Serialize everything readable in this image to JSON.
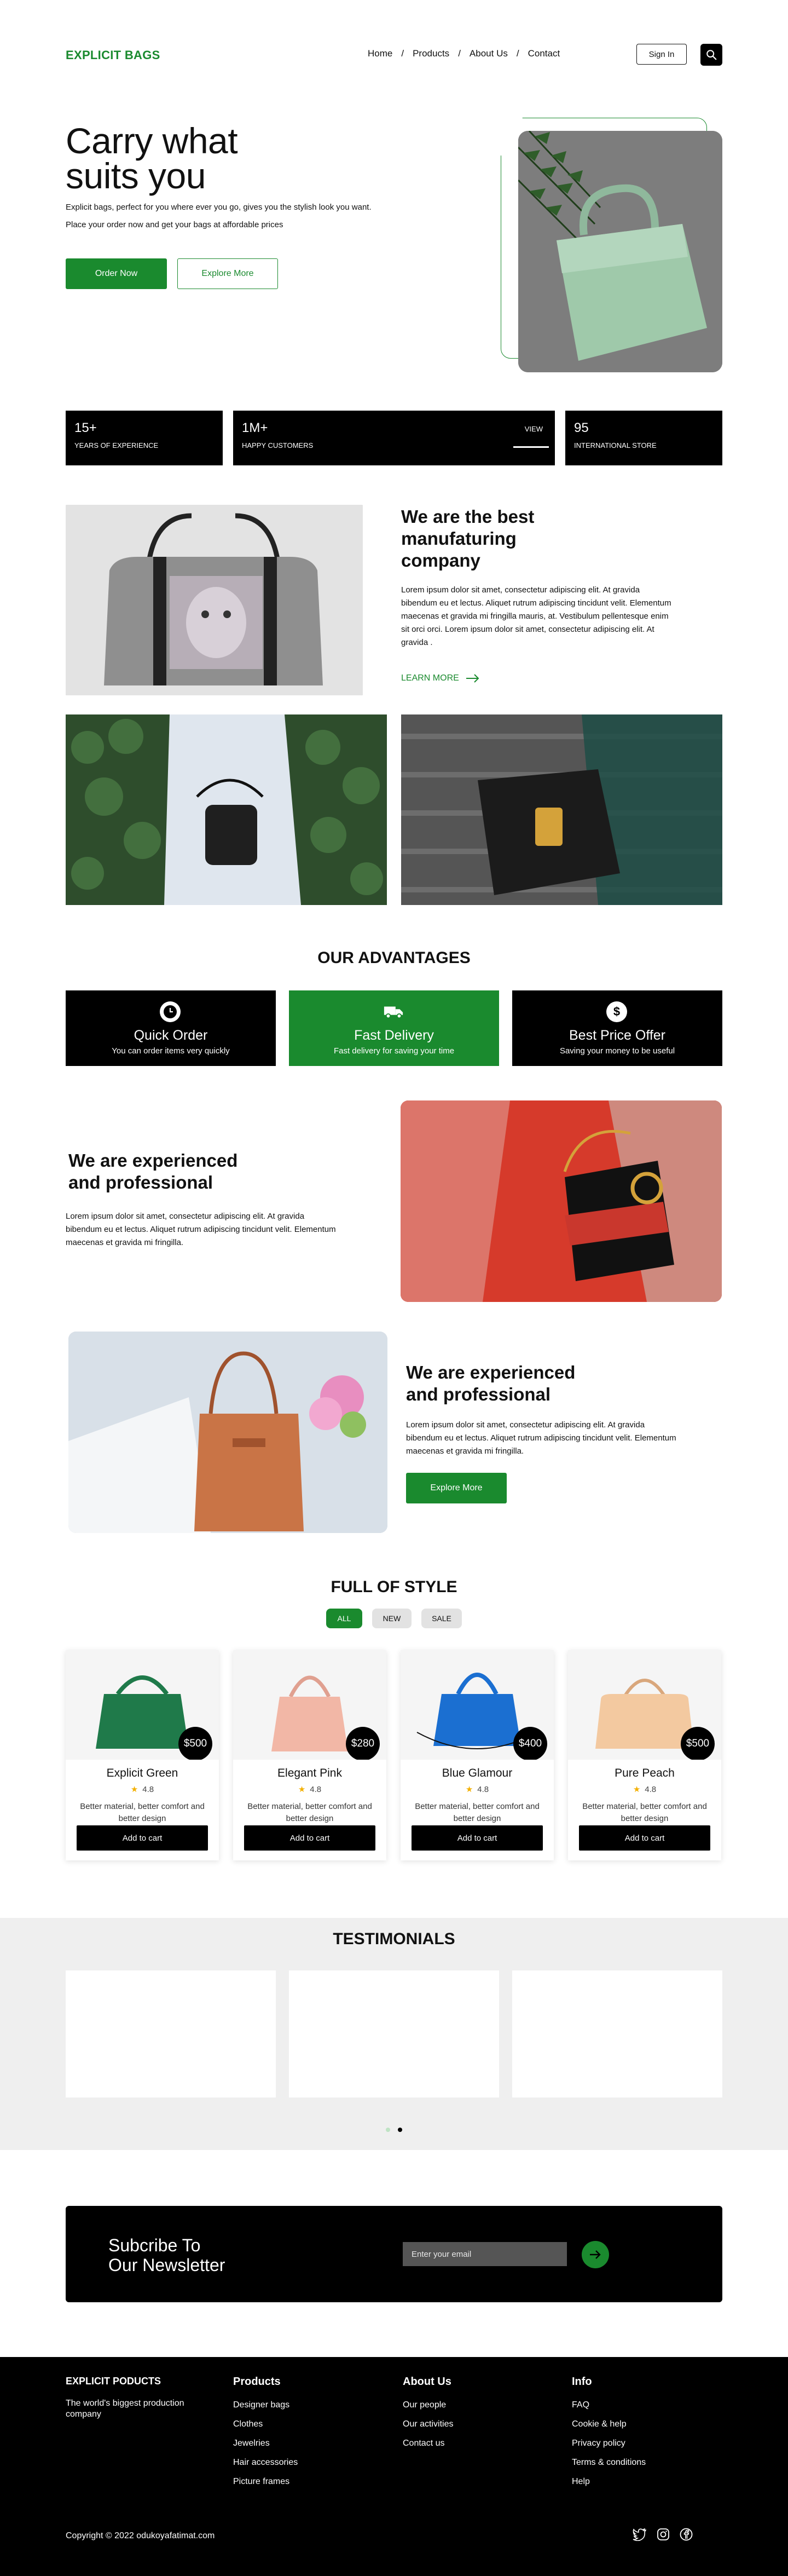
{
  "brand": "EXPLICIT BAGS",
  "nav": {
    "items": [
      "Home",
      "Products",
      "About Us",
      "Contact"
    ],
    "separator": "/",
    "signin": "Sign In"
  },
  "hero": {
    "title_line1": "Carry what",
    "title_line2": "suits you",
    "desc1": "Explicit bags, perfect for you where ever you go, gives you the stylish look you want.",
    "desc2": "Place your order now and get your bags at affordable prices",
    "order_btn": "Order Now",
    "explore_btn": "Explore More"
  },
  "stats": [
    {
      "value": "15+",
      "label": "YEARS OF EXPERIENCE"
    },
    {
      "value": "1M+",
      "label": "HAPPY CUSTOMERS",
      "view": "VIEW",
      "progress": 0.77
    },
    {
      "value": "95",
      "label": "INTERNATIONAL STORE"
    }
  ],
  "company": {
    "title_l1": "We are the best",
    "title_l2": "manufaturing",
    "title_l3": "company",
    "text": "Lorem ipsum dolor sit amet, consectetur adipiscing elit. At gravida bibendum eu et lectus. Aliquet rutrum adipiscing tincidunt velit. Elementum maecenas et gravida mi fringilla mauris, at. Vestibulum pellentesque enim sit orci orci. Lorem ipsum dolor sit amet, consectetur adipiscing elit. At gravida .",
    "learn_more": "LEARN MORE"
  },
  "advantages": {
    "title": "OUR ADVANTAGES",
    "items": [
      {
        "icon": "clock-icon",
        "title": "Quick Order",
        "subtitle": "You can order items very quickly"
      },
      {
        "icon": "truck-icon",
        "title": "Fast Delivery",
        "subtitle": "Fast delivery for saving your time"
      },
      {
        "icon": "dollar-icon",
        "title": "Best Price Offer",
        "subtitle": "Saving your money to be useful"
      }
    ]
  },
  "experience1": {
    "title_l1": "We are experienced",
    "title_l2": "and professional",
    "text": "Lorem ipsum dolor sit amet, consectetur adipiscing elit. At gravida bibendum eu et lectus. Aliquet rutrum adipiscing tincidunt velit. Elementum maecenas et gravida mi fringilla."
  },
  "experience2": {
    "title_l1": "We are experienced",
    "title_l2": "and professional",
    "text": "Lorem ipsum dolor sit amet, consectetur adipiscing elit. At gravida bibendum eu et lectus. Aliquet rutrum adipiscing tincidunt velit. Elementum maecenas et gravida mi fringilla.",
    "button": "Explore More"
  },
  "style": {
    "title": "FULL OF STYLE",
    "filters": [
      "ALL",
      "NEW",
      "SALE"
    ],
    "products": [
      {
        "name": "Explicit Green",
        "price": "$500",
        "rating": "4.8",
        "desc": "Better material, better comfort and better design",
        "cta": "Add to cart",
        "color": "#1f7a4a"
      },
      {
        "name": "Elegant Pink",
        "price": "$280",
        "rating": "4.8",
        "desc": "Better material, better comfort and better design",
        "cta": "Add to cart",
        "color": "#f2b7a6"
      },
      {
        "name": "Blue Glamour",
        "price": "$400",
        "rating": "4.8",
        "desc": "Better material, better comfort and better design",
        "cta": "Add to cart",
        "color": "#1b6fd1"
      },
      {
        "name": "Pure Peach",
        "price": "$500",
        "rating": "4.8",
        "desc": "Better material, better comfort and better design",
        "cta": "Add to cart",
        "color": "#f3c9a0"
      }
    ]
  },
  "testimonials": {
    "title": "TESTIMONIALS"
  },
  "newsletter": {
    "title_l1": "Subcribe To",
    "title_l2": "Our Newsletter",
    "placeholder": "Enter your email"
  },
  "footer": {
    "brand": "EXPLICIT PODUCTS",
    "tagline": "The world's biggest production company",
    "products": {
      "title": "Products",
      "links": [
        "Designer bags",
        "Clothes",
        "Jewelries",
        "Hair accessories",
        "Picture frames"
      ]
    },
    "about": {
      "title": "About Us",
      "links": [
        "Our people",
        "Our activities",
        "Contact us"
      ]
    },
    "info": {
      "title": "Info",
      "links": [
        "FAQ",
        "Cookie & help",
        "Privacy policy",
        "Terms & conditions",
        "Help"
      ]
    },
    "copyright": "Copyright © 2022 odukoyafatimat.com"
  },
  "colors": {
    "accent": "#1a8a2e",
    "dark": "#000000",
    "light_bg": "#efefef"
  }
}
